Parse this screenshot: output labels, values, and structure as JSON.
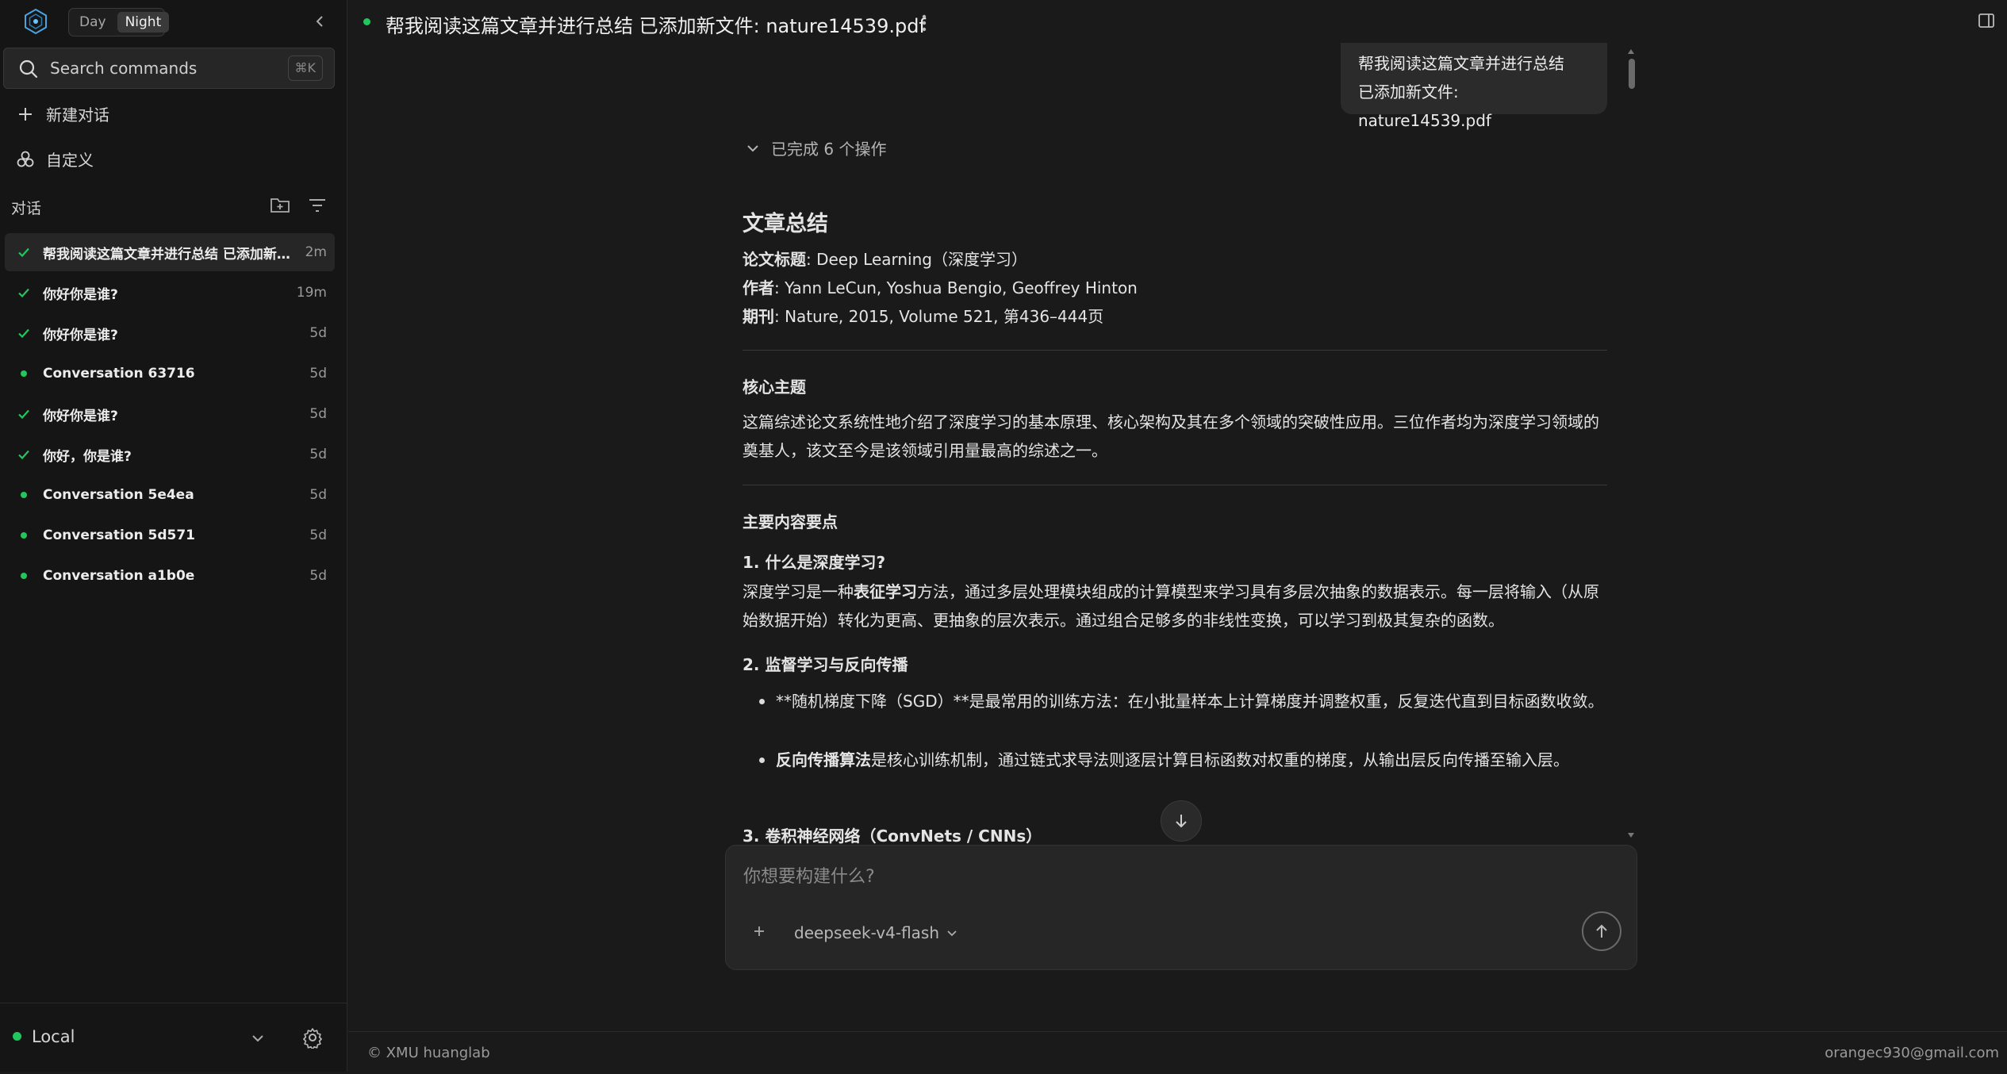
{
  "sidebar": {
    "mode_day": "Day",
    "mode_night": "Night",
    "search_label": "Search commands",
    "search_shortcut": "⌘K",
    "new_chat": "新建对话",
    "customize": "自定义",
    "conversations_header": "对话",
    "conversations": [
      {
        "title": "帮我阅读这篇文章并进行总结 已添加新文件: nature14539.pdf",
        "age": "2m",
        "status": "done",
        "active": true
      },
      {
        "title": "你好你是谁?",
        "age": "19m",
        "status": "done"
      },
      {
        "title": "你好你是谁?",
        "age": "5d",
        "status": "done"
      },
      {
        "title": "Conversation 63716",
        "age": "5d",
        "status": "dot"
      },
      {
        "title": "你好你是谁?",
        "age": "5d",
        "status": "done"
      },
      {
        "title": "你好，你是谁?",
        "age": "5d",
        "status": "done"
      },
      {
        "title": "Conversation 5e4ea",
        "age": "5d",
        "status": "dot"
      },
      {
        "title": "Conversation 5d571",
        "age": "5d",
        "status": "dot"
      },
      {
        "title": "Conversation a1b0e",
        "age": "5d",
        "status": "dot"
      }
    ],
    "environment": "Local"
  },
  "header": {
    "title": "帮我阅读这篇文章并进行总结 已添加新文件: nature14539.pdf"
  },
  "chat": {
    "user_message_line1": "帮我阅读这篇文章并进行总结",
    "user_message_line2": "已添加新文件: nature14539.pdf",
    "operations_summary": "已完成 6 个操作",
    "article": {
      "title": "文章总结",
      "meta": [
        {
          "label": "论文标题",
          "value": ": Deep Learning（深度学习）"
        },
        {
          "label": "作者",
          "value": ": Yann LeCun, Yoshua Bengio, Geoffrey Hinton"
        },
        {
          "label": "期刊",
          "value": ": Nature, 2015, Volume 521, 第436–444页"
        }
      ],
      "core_heading": "核心主题",
      "core_text": "这篇综述论文系统性地介绍了深度学习的基本原理、核心架构及其在多个领域的突破性应用。三位作者均为深度学习领域的奠基人，该文至今是该领域引用量最高的综述之一。",
      "main_heading": "主要内容要点",
      "s1_heading": "1. 什么是深度学习?",
      "s1_pre": "深度学习是一种",
      "s1_bold": "表征学习",
      "s1_post": "方法，通过多层处理模块组成的计算模型来学习具有多层次抽象的数据表示。每一层将输入（从原始数据开始）转化为更高、更抽象的层次表示。通过组合足够多的非线性变换，可以学习到极其复杂的函数。",
      "s2_heading": "2. 监督学习与反向传播",
      "s2_b1": "**随机梯度下降（SGD）**是最常用的训练方法：在小批量样本上计算梯度并调整权重，反复迭代直到目标函数收敛。",
      "s2_b2_bold": "反向传播算法",
      "s2_b2_rest": "是核心训练机制，通过链式求导法则逐层计算目标函数对权重的梯度，从输出层反向传播至输入层。",
      "s3_heading": "3. 卷积神经网络（ConvNets / CNNs）"
    }
  },
  "composer": {
    "placeholder": "你想要构建什么?",
    "model": "deepseek-v4-flash"
  },
  "footer": {
    "left": "© XMU huanglab",
    "right": "orangec930@gmail.com"
  },
  "colors": {
    "accent_green": "#22c55e",
    "background": "#1a1a1a",
    "sidebar": "#151515"
  }
}
